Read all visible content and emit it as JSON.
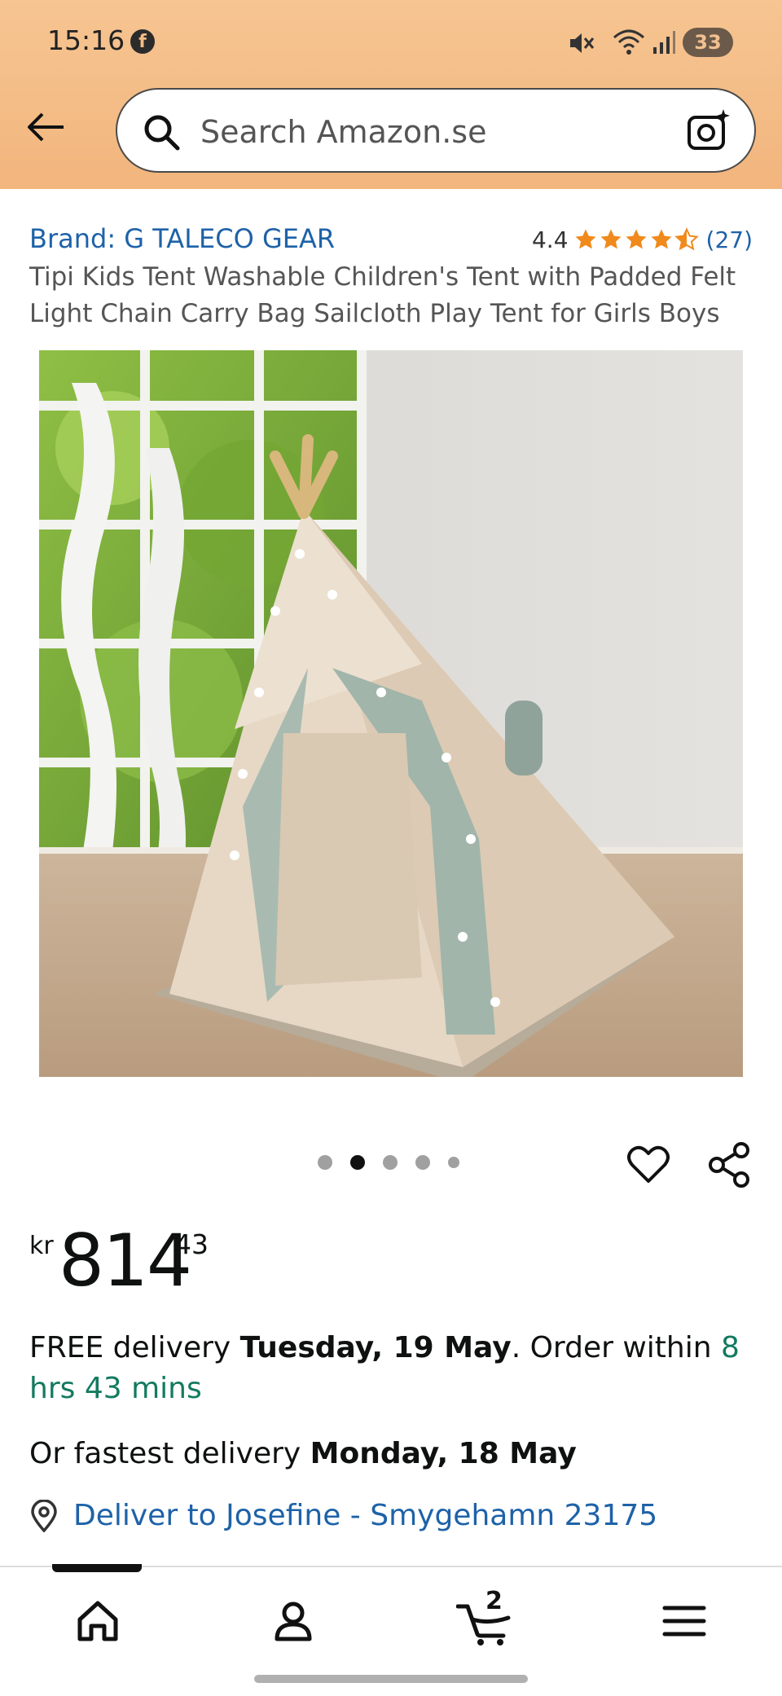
{
  "status_bar": {
    "time": "15:16",
    "battery": "33"
  },
  "search": {
    "placeholder": "Search Amazon.se"
  },
  "product": {
    "brand": "Brand: G TALECO GEAR",
    "rating": "4.4",
    "stars_value": 4.4,
    "review_count": "(27)",
    "title": "Tipi Kids Tent Washable Children's Tent with Padded Felt Light Chain Carry Bag Sailcloth Play Tent for Girls Boys",
    "image_count": 5,
    "active_image_index": 1
  },
  "price": {
    "currency": "kr",
    "whole": "814",
    "fraction": "43"
  },
  "delivery": {
    "prefix": "FREE delivery ",
    "date": "Tuesday, 19 May",
    "middle": ". Order within ",
    "countdown": "8 hrs 43 mins",
    "fastest_prefix": "Or fastest delivery ",
    "fastest_date": "Monday, 18 May",
    "deliver_to": "Deliver to Josefine - Smygehamn 23175"
  },
  "bottom_nav": {
    "cart_count": "2"
  },
  "colors": {
    "header_orange": "#f2b57d",
    "link_blue": "#1e62a8",
    "star_orange": "#f08a1c",
    "green": "#137a60"
  }
}
